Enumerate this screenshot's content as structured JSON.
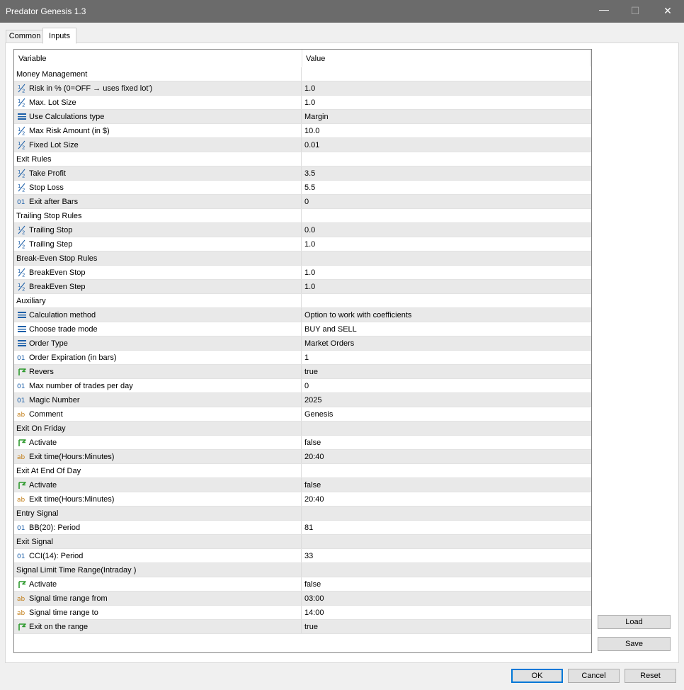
{
  "window": {
    "title": "Predator Genesis 1.3",
    "minimize_glyph": "—",
    "maximize_glyph": "☐",
    "close_glyph": "✕"
  },
  "tabs": [
    {
      "label": "Common",
      "active": false
    },
    {
      "label": "Inputs",
      "active": true
    }
  ],
  "grid": {
    "headers": {
      "variable": "Variable",
      "value": "Value"
    },
    "rows": [
      {
        "type": "group",
        "label": "Money Management"
      },
      {
        "type": "param",
        "icon": "double-icon",
        "label": "Risk in % (0=OFF → uses fixed lot')",
        "value": "1.0"
      },
      {
        "type": "param",
        "icon": "double-icon",
        "label": "Max. Lot Size",
        "value": "1.0"
      },
      {
        "type": "param",
        "icon": "enum-icon",
        "label": "Use Calculations type",
        "value": "Margin"
      },
      {
        "type": "param",
        "icon": "double-icon",
        "label": "Max Risk Amount (in $)",
        "value": "10.0"
      },
      {
        "type": "param",
        "icon": "double-icon",
        "label": "Fixed Lot Size",
        "value": "0.01"
      },
      {
        "type": "group",
        "label": "Exit Rules"
      },
      {
        "type": "param",
        "icon": "double-icon",
        "label": "Take Profit",
        "value": "3.5"
      },
      {
        "type": "param",
        "icon": "double-icon",
        "label": "Stop Loss",
        "value": "5.5"
      },
      {
        "type": "param",
        "icon": "integer-icon",
        "label": "Exit after Bars",
        "value": "0"
      },
      {
        "type": "group",
        "label": "Trailing Stop Rules"
      },
      {
        "type": "param",
        "icon": "double-icon",
        "label": "Trailing Stop",
        "value": "0.0"
      },
      {
        "type": "param",
        "icon": "double-icon",
        "label": "Trailing Step",
        "value": "1.0"
      },
      {
        "type": "group",
        "label": "Break-Even Stop Rules"
      },
      {
        "type": "param",
        "icon": "double-icon",
        "label": "BreakEven Stop",
        "value": "1.0"
      },
      {
        "type": "param",
        "icon": "double-icon",
        "label": "BreakEven Step",
        "value": "1.0"
      },
      {
        "type": "group",
        "label": "Auxiliary"
      },
      {
        "type": "param",
        "icon": "enum-icon",
        "label": "Calculation method",
        "value": "Option to work with coefficients"
      },
      {
        "type": "param",
        "icon": "enum-icon",
        "label": "Choose trade mode",
        "value": "BUY and SELL"
      },
      {
        "type": "param",
        "icon": "enum-icon",
        "label": "Order Type",
        "value": "Market Orders"
      },
      {
        "type": "param",
        "icon": "integer-icon",
        "label": "Order Expiration (in bars)",
        "value": "1"
      },
      {
        "type": "param",
        "icon": "bool-icon",
        "label": "Revers",
        "value": "true"
      },
      {
        "type": "param",
        "icon": "integer-icon",
        "label": "Max number of trades per day",
        "value": "0"
      },
      {
        "type": "param",
        "icon": "integer-icon",
        "label": "Magic Number",
        "value": "2025"
      },
      {
        "type": "param",
        "icon": "string-icon",
        "label": "Comment",
        "value": "Genesis"
      },
      {
        "type": "group",
        "label": "Exit On Friday"
      },
      {
        "type": "param",
        "icon": "bool-icon",
        "label": "Activate",
        "value": "false"
      },
      {
        "type": "param",
        "icon": "string-icon",
        "label": "Exit time(Hours:Minutes)",
        "value": "20:40"
      },
      {
        "type": "group",
        "label": "Exit At End Of Day"
      },
      {
        "type": "param",
        "icon": "bool-icon",
        "label": "Activate",
        "value": "false"
      },
      {
        "type": "param",
        "icon": "string-icon",
        "label": "Exit time(Hours:Minutes)",
        "value": "20:40"
      },
      {
        "type": "group",
        "label": "Entry Signal"
      },
      {
        "type": "param",
        "icon": "integer-icon",
        "label": "BB(20):   Period",
        "value": "81"
      },
      {
        "type": "group",
        "label": "Exit Signal"
      },
      {
        "type": "param",
        "icon": "integer-icon",
        "label": "CCI(14):  Period",
        "value": "33"
      },
      {
        "type": "group",
        "label": "Signal Limit Time Range(Intraday )"
      },
      {
        "type": "param",
        "icon": "bool-icon",
        "label": "Activate",
        "value": "false"
      },
      {
        "type": "param",
        "icon": "string-icon",
        "label": "Signal time range from",
        "value": "03:00"
      },
      {
        "type": "param",
        "icon": "string-icon",
        "label": "Signal time range to",
        "value": "14:00"
      },
      {
        "type": "param",
        "icon": "bool-icon",
        "label": "Exit on the range",
        "value": "true"
      }
    ]
  },
  "side_buttons": {
    "load": "Load",
    "save": "Save"
  },
  "footer_buttons": {
    "ok": "OK",
    "cancel": "Cancel",
    "reset": "Reset"
  },
  "colors": {
    "titlebar": "#6b6b6b",
    "icon_blue": "#1c5fa8",
    "icon_green": "#2e9a2e",
    "icon_orange": "#c07a12"
  }
}
